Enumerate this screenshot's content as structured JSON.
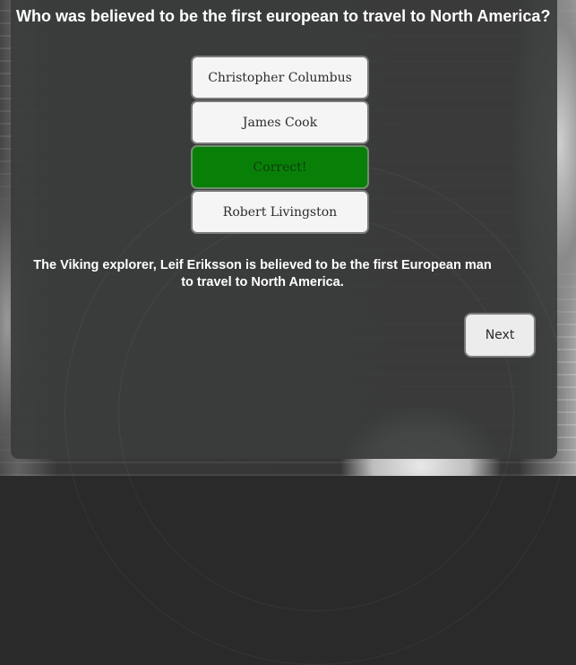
{
  "quiz": {
    "question": "Who was believed to be the first european to travel to North America?",
    "answers": [
      {
        "label": "Christopher Columbus",
        "state": "default"
      },
      {
        "label": "James Cook",
        "state": "default"
      },
      {
        "label": "Correct!",
        "state": "correct"
      },
      {
        "label": "Robert Livingston",
        "state": "default"
      }
    ],
    "explanation": "The Viking explorer, Leif Eriksson is believed to be the first European man to travel to North America.",
    "next_label": "Next"
  },
  "colors": {
    "panel_background": "#3a3b3b",
    "answer_background": "#f5f5f5",
    "correct_background": "#088008",
    "text_light": "#ffffff",
    "text_dark": "#2b2b2b"
  }
}
